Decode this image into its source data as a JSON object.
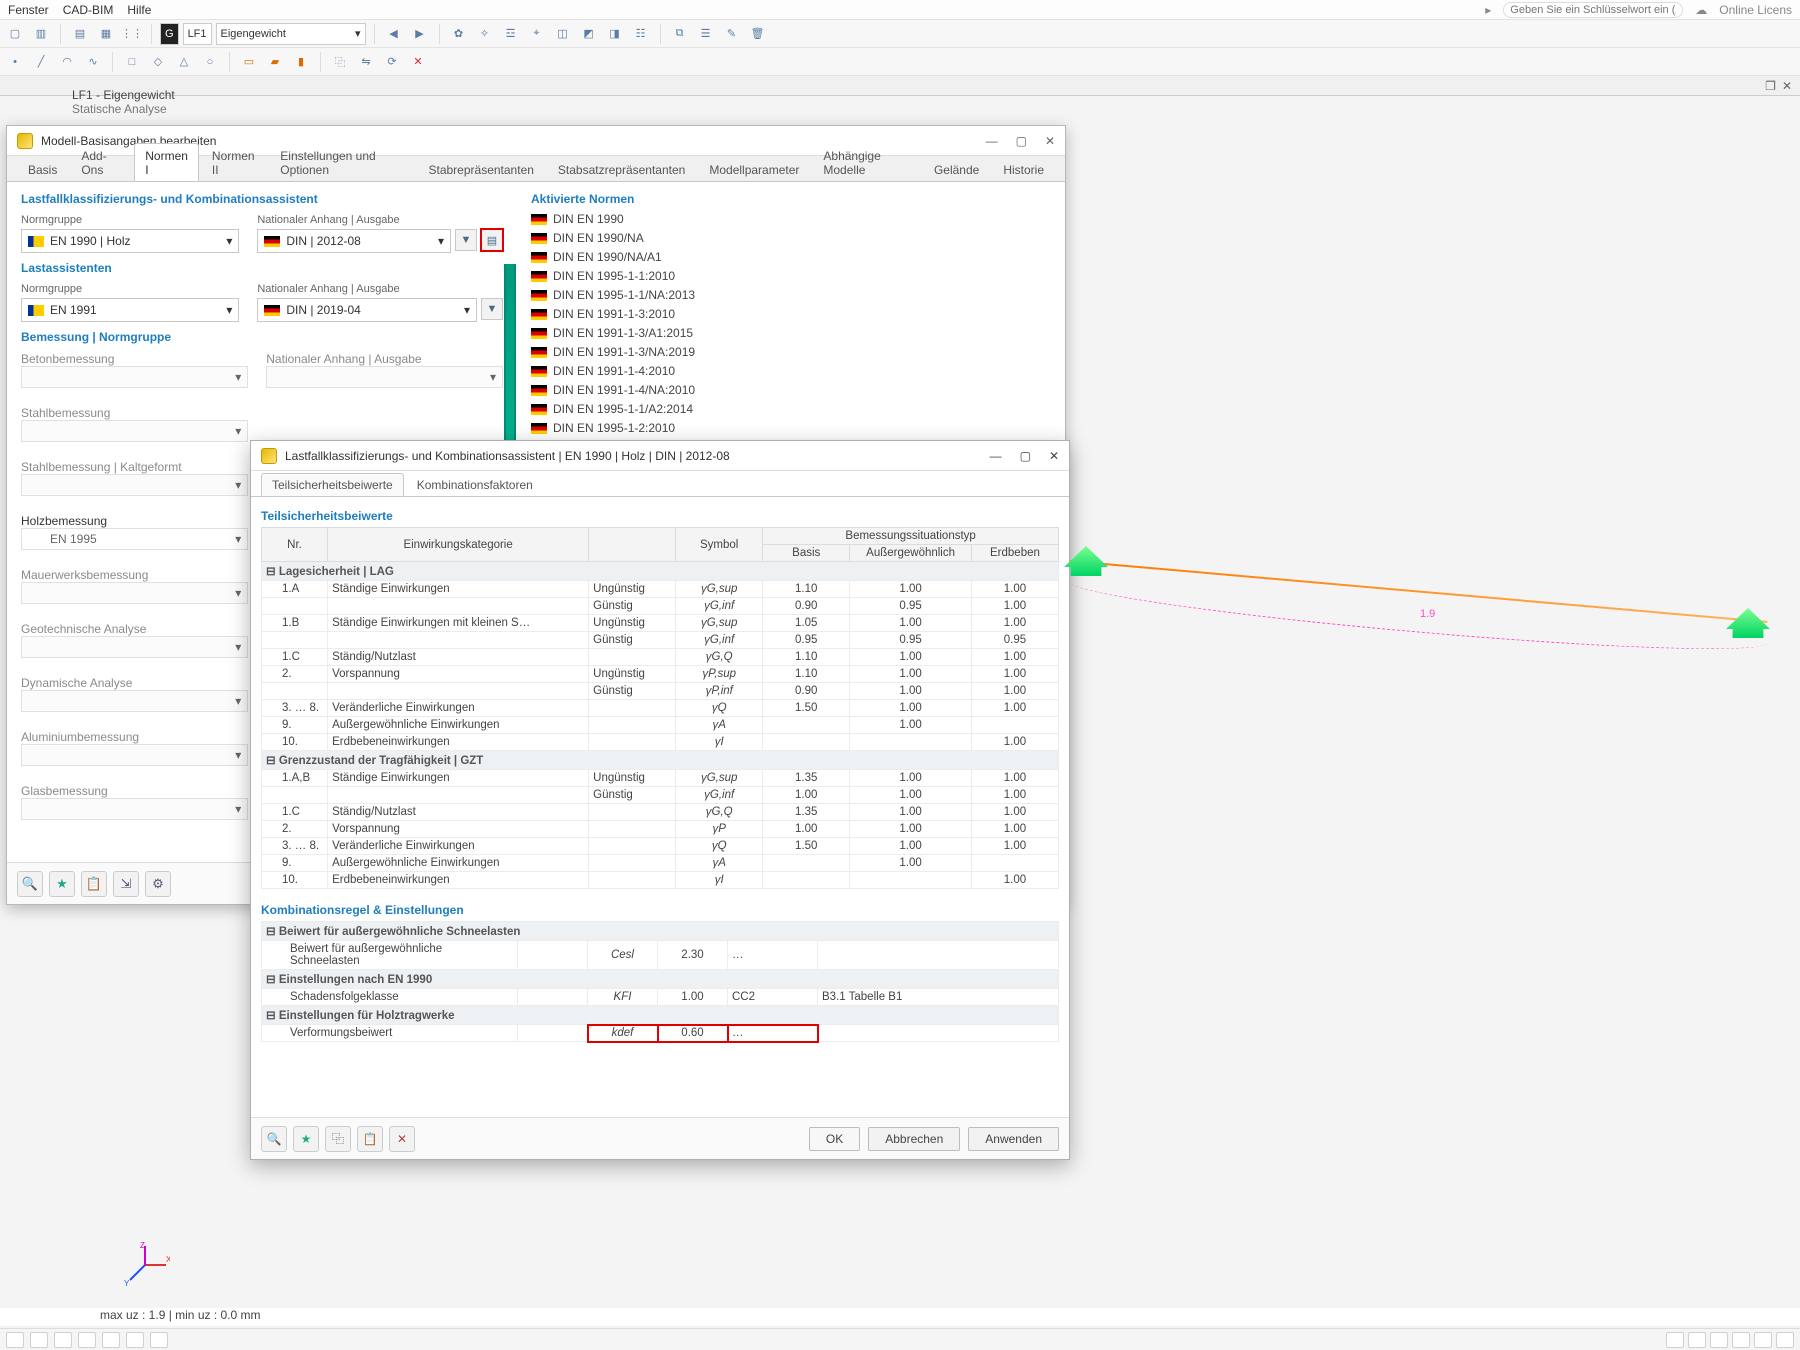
{
  "topmenu": [
    "Fenster",
    "CAD-BIM",
    "Hilfe"
  ],
  "keyword_placeholder": "Geben Sie ein Schlüsselwort ein (Alt+Q)",
  "license": "Online Licens",
  "toolbar2": {
    "lf_code": "G",
    "lf": "LF1",
    "lf_name": "Eigengewicht"
  },
  "doc_title1": "LF1 - Eigengewicht",
  "doc_title2": "Statische Analyse",
  "dimension": "1.9",
  "dialog": {
    "title": "Modell-Basisangaben bearbeiten",
    "tabs": [
      "Basis",
      "Add-Ons",
      "Normen I",
      "Normen II",
      "Einstellungen und Optionen",
      "Stabrepräsentanten",
      "Stabsatzrepräsentanten",
      "Modellparameter",
      "Abhängige Modelle",
      "Gelände",
      "Historie"
    ],
    "active_tab": 2,
    "s1_title": "Lastfallklassifizierungs- und Kombinationsassistent",
    "lastass_title": "Lastassistenten",
    "bemess_title": "Bemessung | Normgruppe",
    "norm_label": "Normgruppe",
    "anhang_label": "Nationaler Anhang | Ausgabe",
    "sel_norm1": "EN 1990 | Holz",
    "sel_ann1": "DIN | 2012-08",
    "sel_norm2": "EN 1991",
    "sel_ann2": "DIN | 2019-04",
    "bemess_items": [
      "Betonbemessung",
      "Stahlbemessung",
      "Stahlbemessung | Kaltgeformt",
      "Holzbemessung",
      "Mauerwerksbemessung",
      "Geotechnische Analyse",
      "Dynamische Analyse",
      "Aluminiumbemessung",
      "Glasbemessung"
    ],
    "holz_norm": "EN 1995",
    "right_title": "Aktivierte Normen",
    "norms": [
      "DIN EN 1990",
      "DIN EN 1990/NA",
      "DIN EN 1990/NA/A1",
      "DIN EN 1995-1-1:2010",
      "DIN EN 1995-1-1/NA:2013",
      "DIN EN 1991-1-3:2010",
      "DIN EN 1991-1-3/A1:2015",
      "DIN EN 1991-1-3/NA:2019",
      "DIN EN 1991-1-4:2010",
      "DIN EN 1991-1-4/NA:2010",
      "DIN EN 1995-1-1/A2:2014",
      "DIN EN 1995-1-2:2010"
    ]
  },
  "dialog2": {
    "title": "Lastfallklassifizierungs- und Kombinationsassistent | EN 1990 | Holz | DIN | 2012-08",
    "tabs": [
      "Teilsicherheitsbeiwerte",
      "Kombinationsfaktoren"
    ],
    "sec1": "Teilsicherheitsbeiwerte",
    "headers": {
      "nr": "Nr.",
      "cat": "Einwirkungskategorie",
      "sym": "Symbol",
      "base": "Basis",
      "bem": "Bemessungssituationstyp",
      "aus": "Außergewöhnlich",
      "erdb": "Erdbeben"
    },
    "group1": "Lagesicherheit | LAG",
    "rows1": [
      {
        "nr": "1.A",
        "cat": "Ständige Einwirkungen",
        "sub": "Ungünstig",
        "sym": "γG,sup",
        "b": "1.10",
        "a": "1.00",
        "e": "1.00"
      },
      {
        "nr": "",
        "cat": "",
        "sub": "Günstig",
        "sym": "γG,inf",
        "b": "0.90",
        "a": "0.95",
        "e": "1.00"
      },
      {
        "nr": "1.B",
        "cat": "Ständige Einwirkungen mit kleinen S…",
        "sub": "Ungünstig",
        "sym": "γG,sup",
        "b": "1.05",
        "a": "1.00",
        "e": "1.00"
      },
      {
        "nr": "",
        "cat": "",
        "sub": "Günstig",
        "sym": "γG,inf",
        "b": "0.95",
        "a": "0.95",
        "e": "0.95"
      },
      {
        "nr": "1.C",
        "cat": "Ständig/Nutzlast",
        "sub": "",
        "sym": "γG,Q",
        "b": "1.10",
        "a": "1.00",
        "e": "1.00"
      },
      {
        "nr": "2.",
        "cat": "Vorspannung",
        "sub": "Ungünstig",
        "sym": "γP,sup",
        "b": "1.10",
        "a": "1.00",
        "e": "1.00"
      },
      {
        "nr": "",
        "cat": "",
        "sub": "Günstig",
        "sym": "γP,inf",
        "b": "0.90",
        "a": "1.00",
        "e": "1.00"
      },
      {
        "nr": "3. … 8.",
        "cat": "Veränderliche Einwirkungen",
        "sub": "",
        "sym": "γQ",
        "b": "1.50",
        "a": "1.00",
        "e": "1.00"
      },
      {
        "nr": "9.",
        "cat": "Außergewöhnliche Einwirkungen",
        "sub": "",
        "sym": "γA",
        "b": "",
        "a": "1.00",
        "e": ""
      },
      {
        "nr": "10.",
        "cat": "Erdbebeneinwirkungen",
        "sub": "",
        "sym": "γI",
        "b": "",
        "a": "",
        "e": "1.00"
      }
    ],
    "group2": "Grenzzustand der Tragfähigkeit | GZT",
    "rows2": [
      {
        "nr": "1.A,B",
        "cat": "Ständige Einwirkungen",
        "sub": "Ungünstig",
        "sym": "γG,sup",
        "b": "1.35",
        "a": "1.00",
        "e": "1.00"
      },
      {
        "nr": "",
        "cat": "",
        "sub": "Günstig",
        "sym": "γG,inf",
        "b": "1.00",
        "a": "1.00",
        "e": "1.00"
      },
      {
        "nr": "1.C",
        "cat": "Ständig/Nutzlast",
        "sub": "",
        "sym": "γG,Q",
        "b": "1.35",
        "a": "1.00",
        "e": "1.00"
      },
      {
        "nr": "2.",
        "cat": "Vorspannung",
        "sub": "",
        "sym": "γP",
        "b": "1.00",
        "a": "1.00",
        "e": "1.00"
      },
      {
        "nr": "3. … 8.",
        "cat": "Veränderliche Einwirkungen",
        "sub": "",
        "sym": "γQ",
        "b": "1.50",
        "a": "1.00",
        "e": "1.00"
      },
      {
        "nr": "9.",
        "cat": "Außergewöhnliche Einwirkungen",
        "sub": "",
        "sym": "γA",
        "b": "",
        "a": "1.00",
        "e": ""
      },
      {
        "nr": "10.",
        "cat": "Erdbebeneinwirkungen",
        "sub": "",
        "sym": "γI",
        "b": "",
        "a": "",
        "e": "1.00"
      }
    ],
    "sec2": "Kombinationsregel & Einstellungen",
    "snow_group": "Beiwert für außergewöhnliche Schneelasten",
    "snow_label": "Beiwert für außergewöhnliche Schneelasten",
    "snow_sym": "Cesl",
    "snow_val": "2.30",
    "snow_dots": "…",
    "en_group": "Einstellungen nach EN 1990",
    "en_label": "Schadensfolgeklasse",
    "en_sym": "KFI",
    "en_v1": "1.00",
    "en_v2": "CC2",
    "en_ref": "B3.1 Tabelle B1",
    "holz_group": "Einstellungen für Holztragwerke",
    "holz_label": "Verformungsbeiwert",
    "holz_sym": "kdef",
    "holz_val": "0.60",
    "holz_dots": "…",
    "ok": "OK",
    "cancel": "Abbrechen",
    "apply": "Anwenden"
  },
  "status": "max uz : 1.9 | min uz : 0.0 mm"
}
